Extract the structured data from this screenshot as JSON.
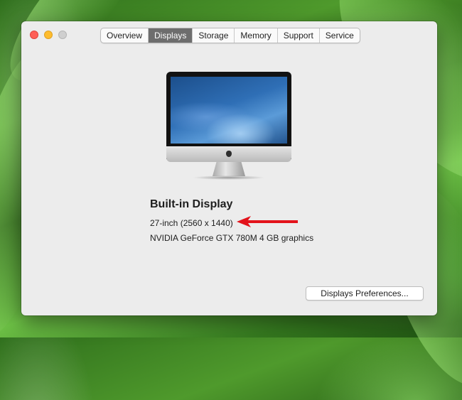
{
  "tabs": [
    {
      "label": "Overview",
      "active": false
    },
    {
      "label": "Displays",
      "active": true
    },
    {
      "label": "Storage",
      "active": false
    },
    {
      "label": "Memory",
      "active": false
    },
    {
      "label": "Support",
      "active": false
    },
    {
      "label": "Service",
      "active": false
    }
  ],
  "display": {
    "name": "Built-in Display",
    "size": "27-inch (2560 x 1440)",
    "graphics": "NVIDIA GeForce GTX 780M 4 GB graphics"
  },
  "buttons": {
    "preferences": "Displays Preferences..."
  },
  "colors": {
    "arrow": "#e3131b",
    "active_tab": "#6d6d6d",
    "close": "#fe5f57",
    "minimize": "#febc2e"
  },
  "icons": [
    "close-button-icon",
    "minimize-button-icon",
    "zoom-button-icon",
    "imac-display-image",
    "red-arrow-annotation"
  ]
}
